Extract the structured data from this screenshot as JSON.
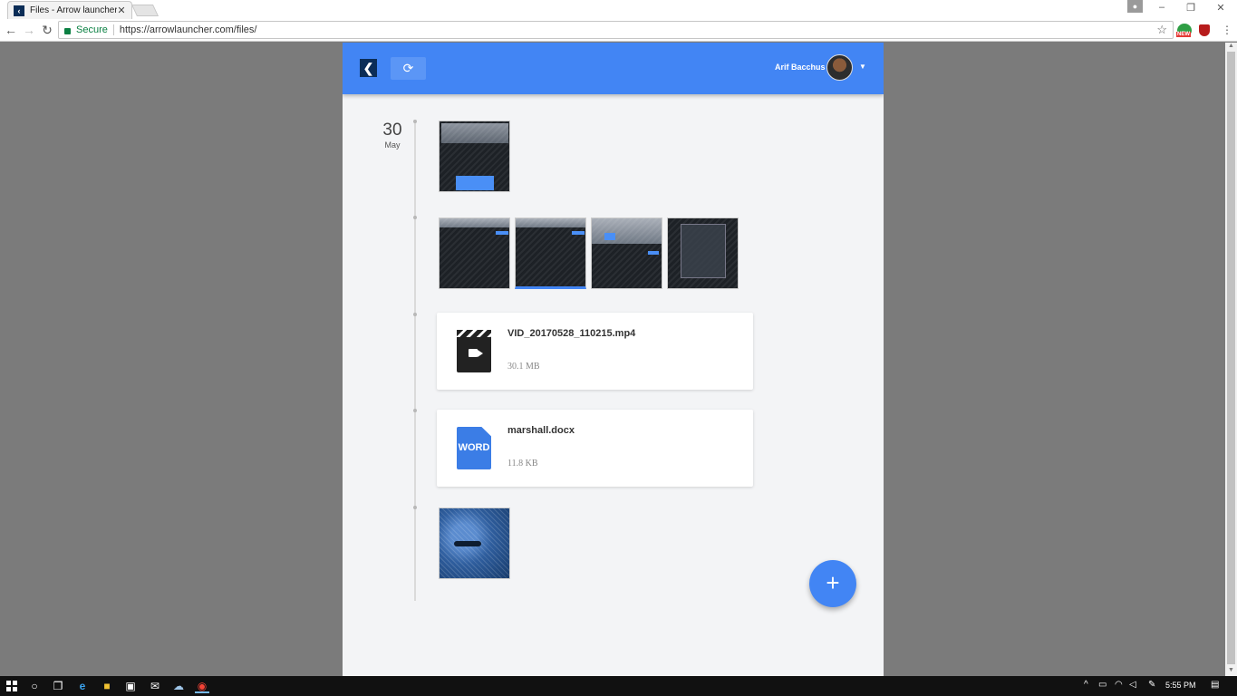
{
  "browser": {
    "tab_title": "Files - Arrow launcher",
    "tab_favicon": "‹",
    "tab_close": "✕",
    "secure_label": "Secure",
    "url": "https://arrowlauncher.com/files/",
    "ext_badge": "NEW"
  },
  "app": {
    "logo": "❮",
    "refresh_icon": "⟳",
    "user_name": "Arif Bacchus",
    "caret": "▼",
    "date_day": "30",
    "date_month": "May",
    "files": [
      {
        "name": "VID_20170528_110215.mp4",
        "size": "30.1 MB",
        "icon": "video-icon"
      },
      {
        "name": "marshall.docx",
        "size": "11.8 KB",
        "icon": "word-icon",
        "icon_text": "WORD"
      }
    ],
    "fab_label": "+"
  },
  "taskbar": {
    "clock": "5:55 PM"
  },
  "colors": {
    "app_bar": "#4285f4",
    "page_bg": "#f3f4f6",
    "outer_bg": "#7b7b7b",
    "secure_green": "#0b8043"
  }
}
